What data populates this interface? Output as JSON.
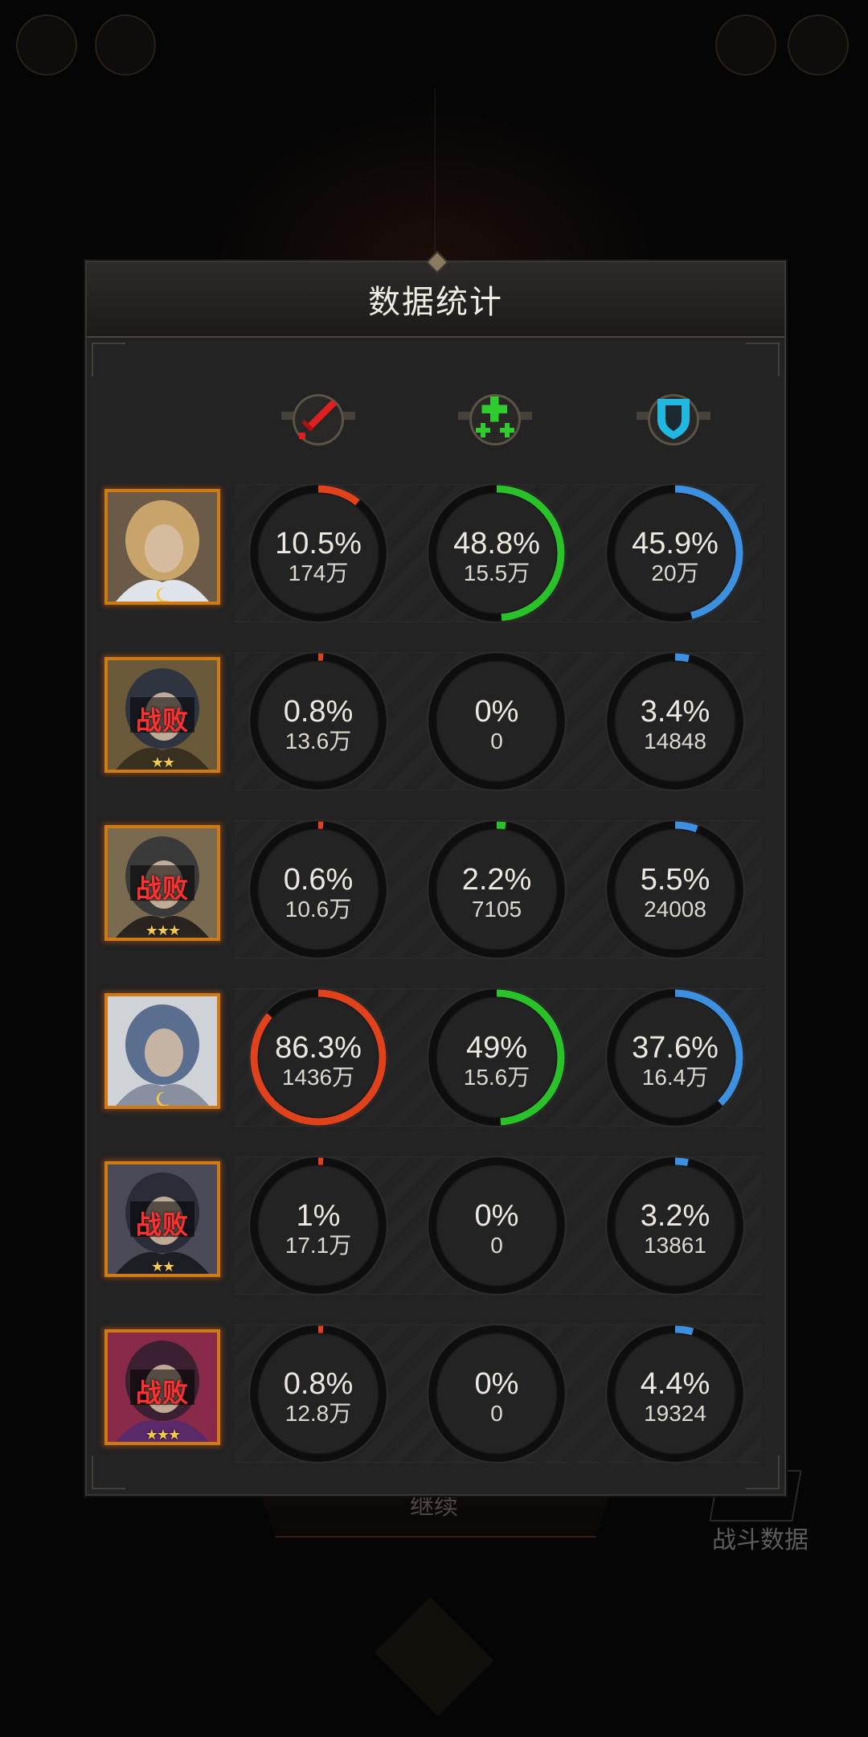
{
  "panel": {
    "title": "数据统计"
  },
  "columns": [
    {
      "icon": "sword-icon",
      "color": "#e02020"
    },
    {
      "icon": "heal-plus-icon",
      "color": "#2ecc2e"
    },
    {
      "icon": "shield-icon",
      "color": "#20b8e0"
    }
  ],
  "colors": {
    "damage": "#e0421c",
    "heal": "#29c229",
    "shield": "#3d8fe0",
    "ring_track": "#0e0e0e",
    "avatar_border": "#d07a14"
  },
  "rows": [
    {
      "defeated": false,
      "status": "",
      "stars": "",
      "damage": {
        "pct": "10.5%",
        "value": "174万",
        "fraction": 0.105
      },
      "heal": {
        "pct": "48.8%",
        "value": "15.5万",
        "fraction": 0.488
      },
      "shield": {
        "pct": "45.9%",
        "value": "20万",
        "fraction": 0.459
      }
    },
    {
      "defeated": true,
      "status": "战败",
      "stars": "★★",
      "damage": {
        "pct": "0.8%",
        "value": "13.6万",
        "fraction": 0.008
      },
      "heal": {
        "pct": "0%",
        "value": "0",
        "fraction": 0
      },
      "shield": {
        "pct": "3.4%",
        "value": "14848",
        "fraction": 0.034
      }
    },
    {
      "defeated": true,
      "status": "战败",
      "stars": "★★★",
      "damage": {
        "pct": "0.6%",
        "value": "10.6万",
        "fraction": 0.006
      },
      "heal": {
        "pct": "2.2%",
        "value": "7105",
        "fraction": 0.022
      },
      "shield": {
        "pct": "5.5%",
        "value": "24008",
        "fraction": 0.055
      }
    },
    {
      "defeated": false,
      "status": "",
      "stars": "",
      "damage": {
        "pct": "86.3%",
        "value": "1436万",
        "fraction": 0.863
      },
      "heal": {
        "pct": "49%",
        "value": "15.6万",
        "fraction": 0.49
      },
      "shield": {
        "pct": "37.6%",
        "value": "16.4万",
        "fraction": 0.376
      }
    },
    {
      "defeated": true,
      "status": "战败",
      "stars": "★★",
      "damage": {
        "pct": "1%",
        "value": "17.1万",
        "fraction": 0.01
      },
      "heal": {
        "pct": "0%",
        "value": "0",
        "fraction": 0
      },
      "shield": {
        "pct": "3.2%",
        "value": "13861",
        "fraction": 0.032
      }
    },
    {
      "defeated": true,
      "status": "战败",
      "stars": "★★★",
      "damage": {
        "pct": "0.8%",
        "value": "12.8万",
        "fraction": 0.008
      },
      "heal": {
        "pct": "0%",
        "value": "0",
        "fraction": 0
      },
      "shield": {
        "pct": "4.4%",
        "value": "19324",
        "fraction": 0.044
      }
    }
  ],
  "background": {
    "continue_label": "继续",
    "battle_data_label": "战斗数据"
  }
}
